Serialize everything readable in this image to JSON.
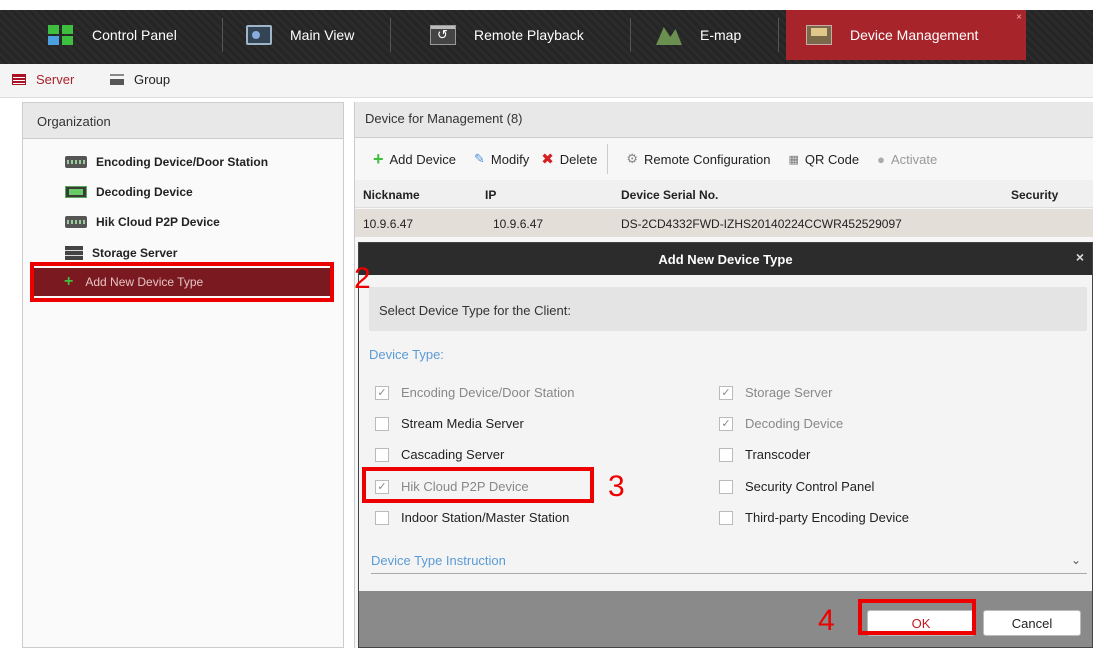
{
  "nav": {
    "tabs": [
      {
        "label": "Control Panel",
        "icon": "control-panel-icon"
      },
      {
        "label": "Main View",
        "icon": "main-view-icon"
      },
      {
        "label": "Remote Playback",
        "icon": "remote-playback-icon"
      },
      {
        "label": "E-map",
        "icon": "emap-icon"
      },
      {
        "label": "Device Management",
        "icon": "device-management-icon",
        "active": true
      }
    ],
    "close_glyph": "×"
  },
  "subtabs": [
    {
      "label": "Server",
      "icon": "server-icon",
      "active": true
    },
    {
      "label": "Group",
      "icon": "group-icon"
    }
  ],
  "organization": {
    "header": "Organization",
    "items": [
      {
        "label": "Encoding Device/Door Station",
        "icon": "encoding-device-icon"
      },
      {
        "label": "Decoding Device",
        "icon": "decoding-device-icon"
      },
      {
        "label": "Hik Cloud P2P Device",
        "icon": "cloud-device-icon"
      },
      {
        "label": "Storage Server",
        "icon": "storage-server-icon"
      },
      {
        "label": "Add New Device Type",
        "icon": "plus-icon",
        "selected": true
      }
    ]
  },
  "management": {
    "header": "Device for Management (8)",
    "toolbar": {
      "add": "Add Device",
      "modify": "Modify",
      "delete": "Delete",
      "remote_config": "Remote Configuration",
      "qr_code": "QR Code",
      "activate": "Activate"
    },
    "columns": [
      "Nickname",
      "IP",
      "Device Serial No.",
      "Security"
    ],
    "rows": [
      {
        "nickname": "10.9.6.47",
        "ip": "10.9.6.47",
        "serial": "DS-2CD4332FWD-IZHS20140224CCWR452529097",
        "security": ""
      }
    ]
  },
  "dialog": {
    "title": "Add New Device Type",
    "close_glyph": "×",
    "prompt": "Select Device Type for the Client:",
    "section": "Device Type:",
    "left_options": [
      {
        "label": "Encoding Device/Door Station",
        "checked": true,
        "disabled": true
      },
      {
        "label": "Stream Media Server",
        "checked": false,
        "disabled": false
      },
      {
        "label": "Cascading Server",
        "checked": false,
        "disabled": false
      },
      {
        "label": "Hik Cloud P2P Device",
        "checked": true,
        "disabled": true
      },
      {
        "label": "Indoor Station/Master Station",
        "checked": false,
        "disabled": false
      }
    ],
    "right_options": [
      {
        "label": "Storage Server",
        "checked": true,
        "disabled": true
      },
      {
        "label": "Decoding Device",
        "checked": true,
        "disabled": true
      },
      {
        "label": "Transcoder",
        "checked": false,
        "disabled": false
      },
      {
        "label": "Security Control Panel",
        "checked": false,
        "disabled": false
      },
      {
        "label": "Third-party Encoding Device",
        "checked": false,
        "disabled": false
      }
    ],
    "instruction": "Device Type Instruction",
    "ok": "OK",
    "cancel": "Cancel"
  },
  "annotations": {
    "step2": "2",
    "step3": "3",
    "step4": "4",
    "color": "#ee0000"
  },
  "colors": {
    "active_tab": "#a8242b",
    "selected_tree_item": "#7a1a20",
    "link_blue": "#5b9bd5",
    "add_green": "#3fbf3f",
    "delete_red": "#d42020"
  }
}
